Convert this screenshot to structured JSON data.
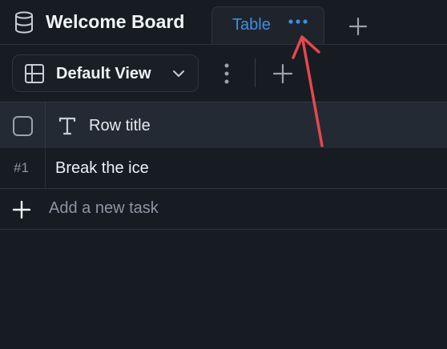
{
  "board": {
    "title": "Welcome Board",
    "icon": "database-icon"
  },
  "tabs": [
    {
      "label": "Table",
      "active": true,
      "more_icon": "more-horizontal-icon"
    }
  ],
  "add_tab_icon": "plus-icon",
  "view": {
    "selected": "Default View",
    "icon": "table-layout-icon",
    "chevron_icon": "chevron-down-icon",
    "menu_icon": "more-vertical-icon",
    "add_icon": "plus-icon"
  },
  "table": {
    "columns": [
      {
        "type_icon": "text-type-icon",
        "title": "Row title"
      }
    ],
    "rows": [
      {
        "number": "#1",
        "title": "Break the ice"
      }
    ],
    "add_task_label": "Add a new task"
  },
  "colors": {
    "background": "#171b22",
    "header": "#232a33",
    "accent": "#3d8fe0",
    "annotation_arrow": "#e5484d"
  }
}
